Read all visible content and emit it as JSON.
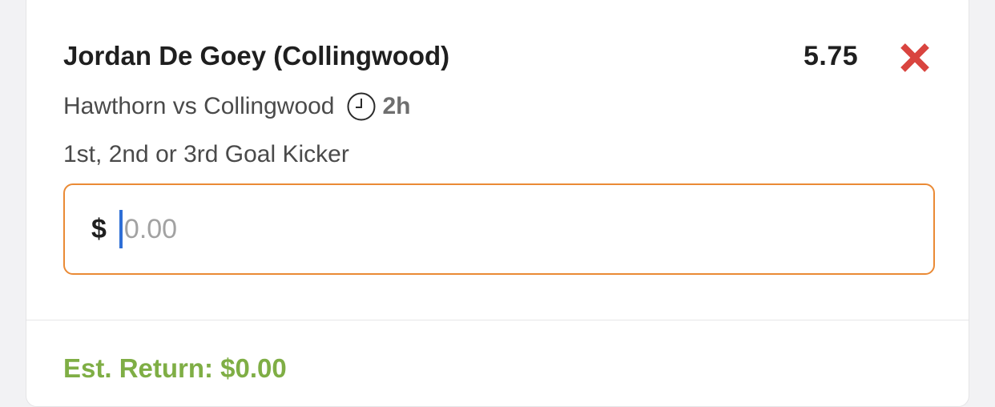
{
  "bet": {
    "selection": "Jordan De Goey (Collingwood)",
    "odds": "5.75",
    "match": "Hawthorn vs Collingwood",
    "time_to_start": "2h",
    "market": "1st, 2nd or 3rd Goal Kicker"
  },
  "stake": {
    "currency_symbol": "$",
    "value": "",
    "placeholder": "0.00"
  },
  "summary": {
    "est_return": "Est. Return: $0.00"
  },
  "icons": {
    "remove": "close-x-icon",
    "clock": "clock-icon"
  },
  "colors": {
    "remove_icon": "#d9443f",
    "input_border": "#ea8a35",
    "caret": "#2f6fd6",
    "est_return": "#7fae45"
  }
}
